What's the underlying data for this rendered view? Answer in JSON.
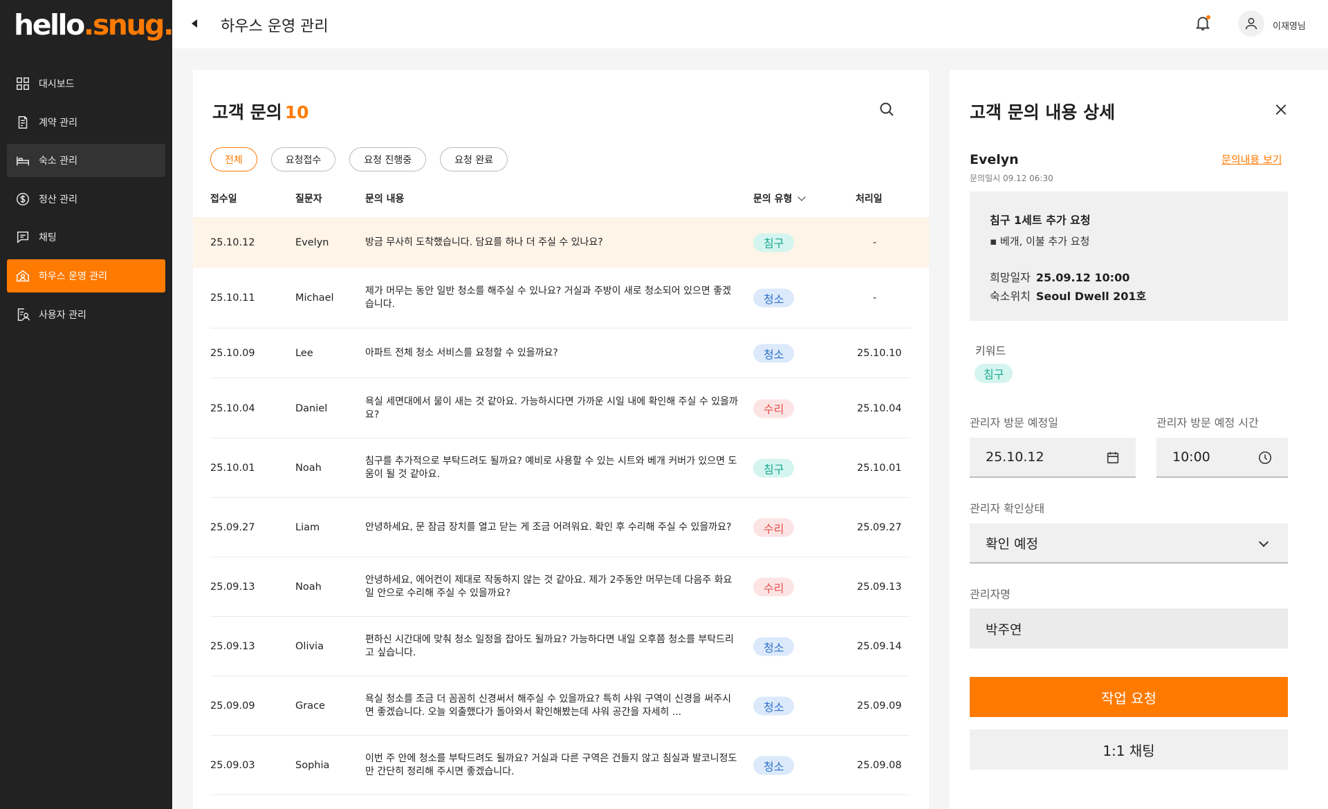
{
  "brand": {
    "name_part1": "hello",
    "name_part2": ".snug.",
    "accent": "#ff7a00"
  },
  "sidebar": {
    "items": [
      {
        "label": "대시보드",
        "icon": "dashboard-icon",
        "state": ""
      },
      {
        "label": "계약 관리",
        "icon": "contract-icon",
        "state": ""
      },
      {
        "label": "숙소 관리",
        "icon": "bed-icon",
        "state": "hover"
      },
      {
        "label": "정산 관리",
        "icon": "dollar-icon",
        "state": ""
      },
      {
        "label": "채팅",
        "icon": "chat-icon",
        "state": ""
      },
      {
        "label": "하우스 운영 관리",
        "icon": "house-icon",
        "state": "active"
      },
      {
        "label": "사용자 관리",
        "icon": "user-manage-icon",
        "state": ""
      }
    ]
  },
  "header": {
    "title": "하우스 운영 관리",
    "user_name": "이재영님"
  },
  "inquiries": {
    "title": "고객 문의",
    "count": "10",
    "filters": [
      {
        "label": "전체",
        "active": true
      },
      {
        "label": "요청접수",
        "active": false
      },
      {
        "label": "요청 진행중",
        "active": false
      },
      {
        "label": "요청 완료",
        "active": false
      }
    ],
    "columns": {
      "date": "접수일",
      "asker": "질문자",
      "content": "문의 내용",
      "type": "문의 유형",
      "processed": "처리일"
    },
    "rows": [
      {
        "date": "25.10.12",
        "asker": "Evelyn",
        "content": "방금 무사히 도착했습니다. 담요를 하나 더 주실 수 있나요?",
        "type": "침구",
        "processed": "-",
        "highlight": true
      },
      {
        "date": "25.10.11",
        "asker": "Michael",
        "content": "제가 머무는 동안 일반 청소를 해주실 수 있나요? 거실과 주방이 새로 청소되어 있으면 좋겠습니다.",
        "type": "청소",
        "processed": "-"
      },
      {
        "date": "25.10.09",
        "asker": "Lee",
        "content": "아파트 전체 청소 서비스를 요청할 수 있을까요?",
        "type": "청소",
        "processed": "25.10.10"
      },
      {
        "date": "25.10.04",
        "asker": "Daniel",
        "content": "욕실 세면대에서 물이 새는 것 같아요. 가능하시다면 가까운 시일 내에 확인해 주실 수 있을까요?",
        "type": "수리",
        "processed": "25.10.04"
      },
      {
        "date": "25.10.01",
        "asker": "Noah",
        "content": "침구를 추가적으로 부탁드려도 될까요? 예비로 사용할 수 있는 시트와 베개 커버가 있으면 도움이 될 것 같아요.",
        "type": "침구",
        "processed": "25.10.01"
      },
      {
        "date": "25.09.27",
        "asker": "Liam",
        "content": "안녕하세요, 문 잠금 장치를 열고 닫는 게 조금 어려워요. 확인 후 수리해 주실 수 있을까요?",
        "type": "수리",
        "processed": "25.09.27"
      },
      {
        "date": "25.09.13",
        "asker": "Noah",
        "content": "안녕하세요, 에어컨이 제대로 작동하지 않는 것 같아요. 제가 2주동안 머무는데 다음주 화요일 안으로 수리해 주실 수 있을까요?",
        "type": "수리",
        "processed": "25.09.13"
      },
      {
        "date": "25.09.13",
        "asker": "Olivia",
        "content": "편하신 시간대에 맞춰 청소 일정을 잡아도 될까요? 가능하다면 내일 오후쯤 청소를 부탁드리고 싶습니다.",
        "type": "청소",
        "processed": "25.09.14"
      },
      {
        "date": "25.09.09",
        "asker": "Grace",
        "content": "욕실 청소를 조금 더 꼼꼼히 신경써서 해주실 수 있을까요? 특히 샤워 구역이 신경을 써주시면 좋겠습니다. 오늘 외출했다가 돌아와서 확인해봤는데 샤워 공간을 자세히 ...",
        "type": "청소",
        "processed": "25.09.09"
      },
      {
        "date": "25.09.03",
        "asker": "Sophia",
        "content": "이번 주 안에 청소를 부탁드려도 될까요? 거실과 다른 구역은 건들지 않고 침실과 발코니정도만 간단히 정리해 주시면 좋겠습니다.",
        "type": "청소",
        "processed": "25.09.08"
      }
    ],
    "type_colors": {
      "침구": {
        "bg": "#d4f5ef",
        "fg": "#1aa88e"
      },
      "청소": {
        "bg": "#dbe9fb",
        "fg": "#2f72c7"
      },
      "수리": {
        "bg": "#fde4e4",
        "fg": "#e0504d"
      }
    }
  },
  "detail": {
    "title": "고객 문의 내용 상세",
    "name": "Evelyn",
    "inquiry_date": "문의일시 09.12 06:30",
    "view_link": "문의내용 보기",
    "summary": {
      "title": "침구 1세트 추가 요청",
      "bullet": "▪ 베개, 이불 추가 요청",
      "desired_date_label": "희망일자",
      "desired_date_value": "25.09.12 10:00",
      "location_label": "숙소위치",
      "location_value": "Seoul Dwell 201호"
    },
    "keyword_label": "키워드",
    "keyword": "침구",
    "visit_date_label": "관리자 방문 예정일",
    "visit_date": "25.10.12",
    "visit_time_label": "관리자 방문 예정 시간",
    "visit_time": "10:00",
    "status_label": "관리자 확인상태",
    "status": "확인 예정",
    "manager_label": "관리자명",
    "manager": "박주연",
    "request_button": "작업 요청",
    "chat_button": "1:1 채팅"
  }
}
